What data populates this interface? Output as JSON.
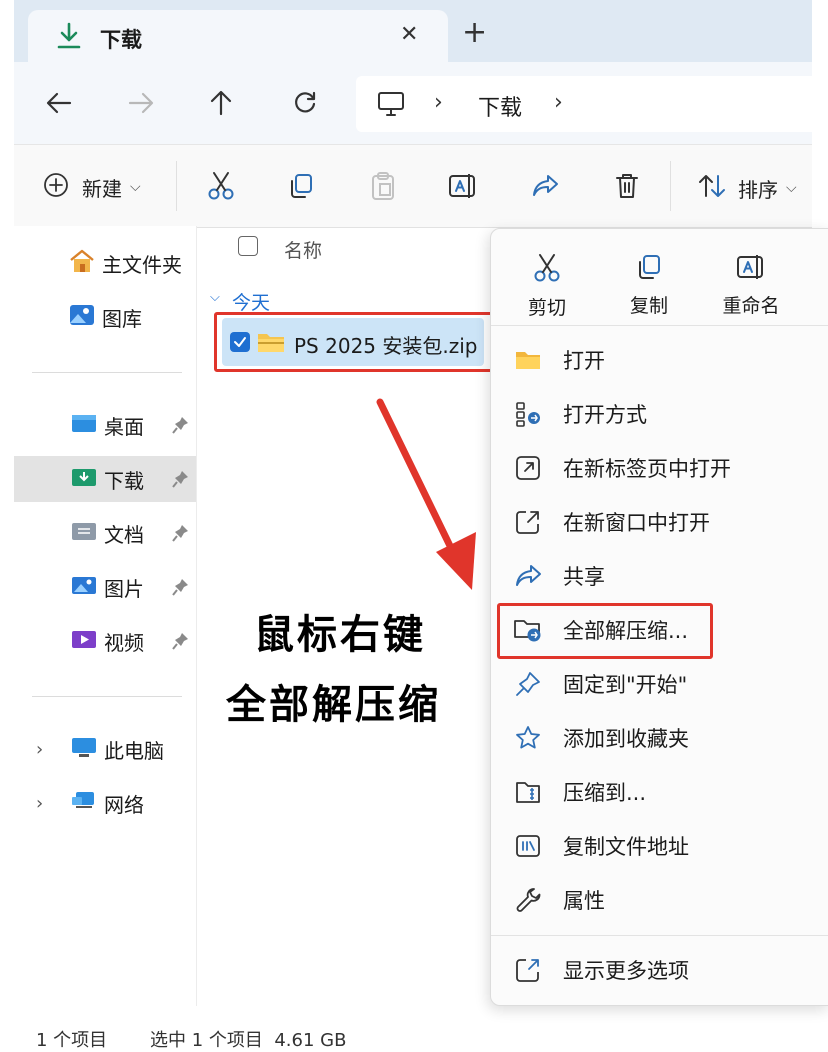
{
  "tab": {
    "title": "下载",
    "close_glyph": "✕",
    "new_tab_glyph": "+"
  },
  "address": {
    "segments": [
      "下载"
    ]
  },
  "toolbar": {
    "new_label": "新建",
    "sort_label": "排序"
  },
  "sidebar": {
    "home": "主文件夹",
    "gallery": "图库",
    "pinned": [
      {
        "label": "桌面"
      },
      {
        "label": "下载"
      },
      {
        "label": "文档"
      },
      {
        "label": "图片"
      },
      {
        "label": "视频"
      }
    ],
    "this_pc": "此电脑",
    "network": "网络"
  },
  "filelist": {
    "column_name": "名称",
    "group_label": "今天",
    "files": [
      {
        "name": "PS 2025 安装包.zip",
        "selected": true
      }
    ]
  },
  "context_menu": {
    "top_actions": [
      {
        "label": "剪切",
        "icon": "scissors-icon"
      },
      {
        "label": "复制",
        "icon": "copy-icon"
      },
      {
        "label": "重命名",
        "icon": "rename-icon"
      }
    ],
    "items": [
      {
        "label": "打开",
        "icon": "folder-icon"
      },
      {
        "label": "打开方式",
        "icon": "open-with-icon"
      },
      {
        "label": "在新标签页中打开",
        "icon": "new-tab-icon"
      },
      {
        "label": "在新窗口中打开",
        "icon": "new-window-icon"
      },
      {
        "label": "共享",
        "icon": "share-icon"
      },
      {
        "label": "全部解压缩...",
        "icon": "extract-icon"
      },
      {
        "label": "固定到\"开始\"",
        "icon": "pin-icon"
      },
      {
        "label": "添加到收藏夹",
        "icon": "star-icon"
      },
      {
        "label": "压缩到...",
        "icon": "compress-icon"
      },
      {
        "label": "复制文件地址",
        "icon": "copy-path-icon"
      },
      {
        "label": "属性",
        "icon": "wrench-icon"
      },
      {
        "label": "显示更多选项",
        "icon": "more-options-icon"
      }
    ]
  },
  "annotation": {
    "line1": "鼠标右键",
    "line2": "全部解压缩"
  },
  "status": {
    "count": "1 个项目",
    "selection": "选中 1 个项目  4.61 GB"
  },
  "colors": {
    "accent": "#1f6fd1",
    "highlight": "#e0352b",
    "selected_bg": "#cce4f7"
  }
}
